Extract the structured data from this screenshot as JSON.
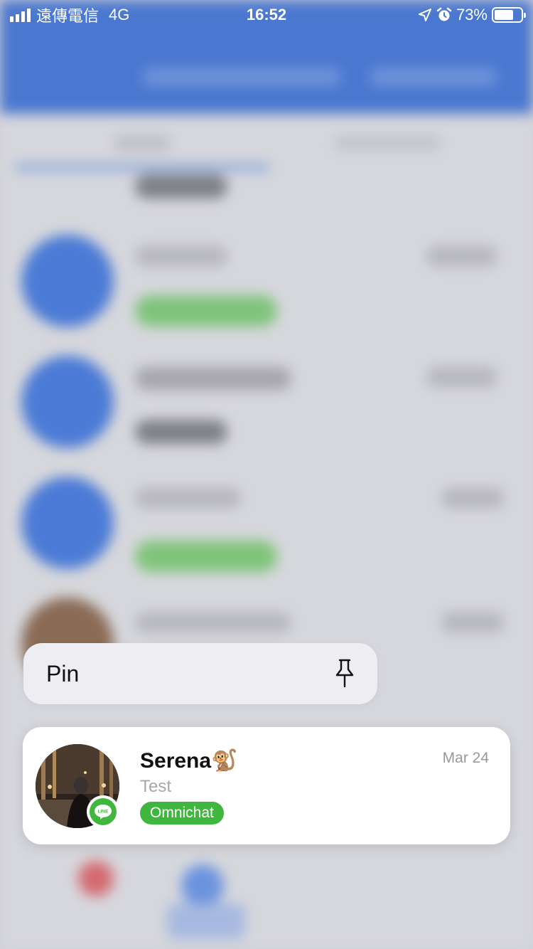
{
  "status_bar": {
    "carrier": "遠傳電信",
    "network": "4G",
    "time": "16:52",
    "battery": "73%",
    "battery_level": 0.73
  },
  "context_menu": {
    "pin_label": "Pin",
    "pin_icon": "pushpin-icon"
  },
  "chat_preview": {
    "name": "Serena🐒",
    "date": "Mar 24",
    "message": "Test",
    "channel_tag": "Omnichat",
    "channel_badge": "LINE",
    "tag_color": "#41b63f"
  }
}
